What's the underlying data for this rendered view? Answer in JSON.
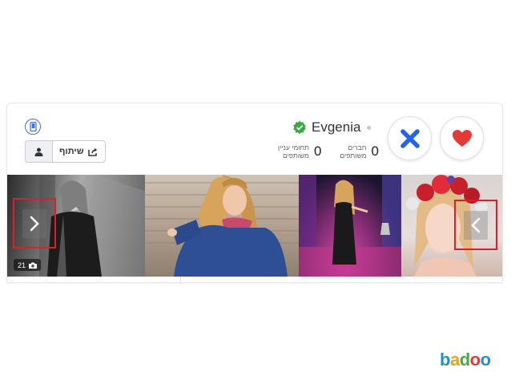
{
  "profile": {
    "name": "Evgenia",
    "stats": [
      {
        "label": "חברים משותפים",
        "value": "0"
      },
      {
        "label": "תחומי עניין משותפים",
        "value": "0"
      }
    ]
  },
  "toolbar": {
    "share_label": "שיתוף"
  },
  "photos": {
    "count": "21"
  },
  "brand": {
    "letters": [
      "b",
      "a",
      "d",
      "o",
      "o"
    ],
    "colors": [
      "#1f8fd8",
      "#f0a020",
      "#45b040",
      "#e03a3a",
      "#1f8fd8"
    ]
  },
  "colors": {
    "accent_blue": "#2563eb",
    "heart_red": "#e53935",
    "verified_green": "#3aa845",
    "highlight_red": "#e02020"
  }
}
